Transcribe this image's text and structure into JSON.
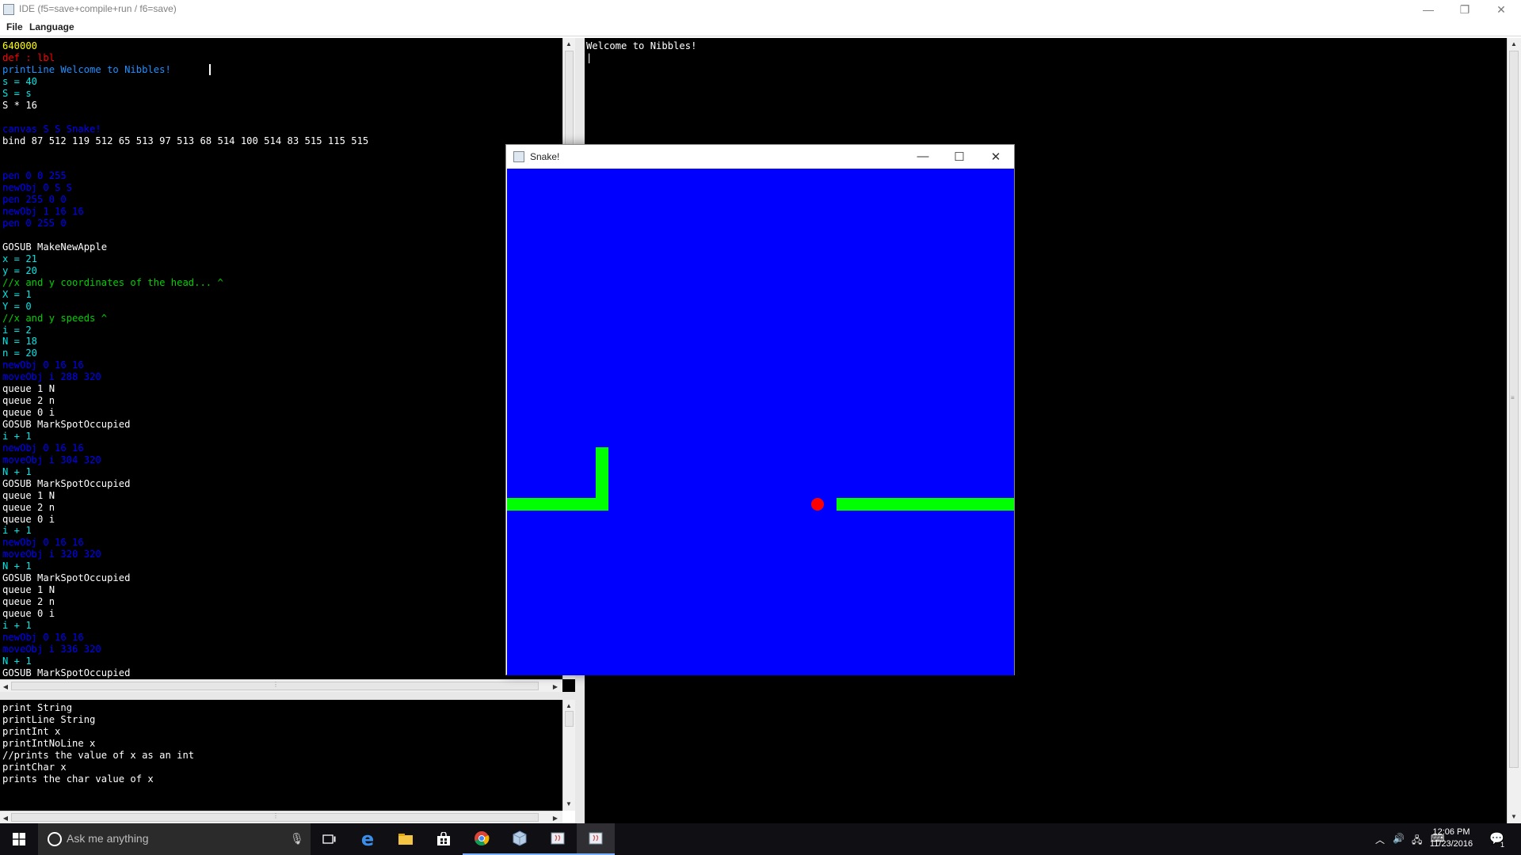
{
  "window": {
    "title": "IDE (f5=save+compile+run / f6=save)",
    "controls": {
      "minimize": "—",
      "restore": "❐",
      "close": "✕"
    }
  },
  "menu": [
    "File",
    "Language"
  ],
  "editor": {
    "lines": [
      {
        "t": "640000",
        "c": "#ffff00"
      },
      {
        "t": "def : lbl",
        "c": "#ff0000"
      },
      {
        "t": "printLine Welcome to Nibbles!",
        "c": "#1e90ff"
      },
      {
        "t": "s = 40",
        "c": "#00e5e5"
      },
      {
        "t": "S = s",
        "c": "#00e5e5"
      },
      {
        "t": "S * 16",
        "c": "#ffffff"
      },
      {
        "t": "",
        "c": "#ffffff"
      },
      {
        "t": "canvas S S Snake!",
        "c": "#0000ff"
      },
      {
        "t": "bind 87 512 119 512 65 513 97 513 68 514 100 514 83 515 115 515",
        "c": "#ffffff"
      },
      {
        "t": "",
        "c": "#ffffff"
      },
      {
        "t": "",
        "c": "#ffffff"
      },
      {
        "t": "pen 0 0 255",
        "c": "#0000ff"
      },
      {
        "t": "newObj 0 S S",
        "c": "#0000ff"
      },
      {
        "t": "pen 255 0 0",
        "c": "#0000ff"
      },
      {
        "t": "newObj 1 16 16",
        "c": "#0000ff"
      },
      {
        "t": "pen 0 255 0",
        "c": "#0000ff"
      },
      {
        "t": "",
        "c": "#ffffff"
      },
      {
        "t": "GOSUB MakeNewApple",
        "c": "#ffffff"
      },
      {
        "t": "x = 21",
        "c": "#00e5e5"
      },
      {
        "t": "y = 20",
        "c": "#00e5e5"
      },
      {
        "t": "//x and y coordinates of the head... ^",
        "c": "#00d000"
      },
      {
        "t": "X = 1",
        "c": "#00e5e5"
      },
      {
        "t": "Y = 0",
        "c": "#00e5e5"
      },
      {
        "t": "//x and y speeds ^",
        "c": "#00d000"
      },
      {
        "t": "i = 2",
        "c": "#00e5e5"
      },
      {
        "t": "N = 18",
        "c": "#00e5e5"
      },
      {
        "t": "n = 20",
        "c": "#00e5e5"
      },
      {
        "t": "newObj 0 16 16",
        "c": "#0000ff"
      },
      {
        "t": "moveObj i 288 320",
        "c": "#0000ff"
      },
      {
        "t": "queue 1 N",
        "c": "#ffffff"
      },
      {
        "t": "queue 2 n",
        "c": "#ffffff"
      },
      {
        "t": "queue 0 i",
        "c": "#ffffff"
      },
      {
        "t": "GOSUB MarkSpotOccupied",
        "c": "#ffffff"
      },
      {
        "t": "i + 1",
        "c": "#00e5e5"
      },
      {
        "t": "newObj 0 16 16",
        "c": "#0000ff"
      },
      {
        "t": "moveObj i 304 320",
        "c": "#0000ff"
      },
      {
        "t": "N + 1",
        "c": "#00e5e5"
      },
      {
        "t": "GOSUB MarkSpotOccupied",
        "c": "#ffffff"
      },
      {
        "t": "queue 1 N",
        "c": "#ffffff"
      },
      {
        "t": "queue 2 n",
        "c": "#ffffff"
      },
      {
        "t": "queue 0 i",
        "c": "#ffffff"
      },
      {
        "t": "i + 1",
        "c": "#00e5e5"
      },
      {
        "t": "newObj 0 16 16",
        "c": "#0000ff"
      },
      {
        "t": "moveObj i 320 320",
        "c": "#0000ff"
      },
      {
        "t": "N + 1",
        "c": "#00e5e5"
      },
      {
        "t": "GOSUB MarkSpotOccupied",
        "c": "#ffffff"
      },
      {
        "t": "queue 1 N",
        "c": "#ffffff"
      },
      {
        "t": "queue 2 n",
        "c": "#ffffff"
      },
      {
        "t": "queue 0 i",
        "c": "#ffffff"
      },
      {
        "t": "i + 1",
        "c": "#00e5e5"
      },
      {
        "t": "newObj 0 16 16",
        "c": "#0000ff"
      },
      {
        "t": "moveObj i 336 320",
        "c": "#0000ff"
      },
      {
        "t": "N + 1",
        "c": "#00e5e5"
      },
      {
        "t": "GOSUB MarkSpotOccupied",
        "c": "#ffffff"
      }
    ]
  },
  "help": {
    "lines": [
      "print String",
      "printLine String",
      "printInt x",
      "printIntNoLine x",
      "//prints the value of x as an int",
      "printChar x",
      "prints the char value of x"
    ]
  },
  "console": {
    "lines": [
      "Welcome to Nibbles!",
      "|"
    ]
  },
  "snake_window": {
    "title": "Snake!",
    "controls": {
      "minimize": "—",
      "maximize": "☐",
      "close": "✕"
    }
  },
  "game": {
    "grid_cells": 40,
    "colors": {
      "background": "#0000ff",
      "snake": "#00ff00",
      "apple": "#ff0000"
    },
    "snake_segments": [
      {
        "col": 0,
        "row": 26
      },
      {
        "col": 1,
        "row": 26
      },
      {
        "col": 2,
        "row": 26
      },
      {
        "col": 3,
        "row": 26
      },
      {
        "col": 4,
        "row": 26
      },
      {
        "col": 5,
        "row": 26
      },
      {
        "col": 6,
        "row": 26
      },
      {
        "col": 7,
        "row": 26
      },
      {
        "col": 7,
        "row": 25
      },
      {
        "col": 7,
        "row": 24
      },
      {
        "col": 7,
        "row": 23
      },
      {
        "col": 7,
        "row": 22
      },
      {
        "col": 26,
        "row": 26
      },
      {
        "col": 27,
        "row": 26
      },
      {
        "col": 28,
        "row": 26
      },
      {
        "col": 29,
        "row": 26
      },
      {
        "col": 30,
        "row": 26
      },
      {
        "col": 31,
        "row": 26
      },
      {
        "col": 32,
        "row": 26
      },
      {
        "col": 33,
        "row": 26
      },
      {
        "col": 34,
        "row": 26
      },
      {
        "col": 35,
        "row": 26
      },
      {
        "col": 36,
        "row": 26
      },
      {
        "col": 37,
        "row": 26
      },
      {
        "col": 38,
        "row": 26
      },
      {
        "col": 39,
        "row": 26
      }
    ],
    "apple": {
      "col": 24,
      "row": 26
    }
  },
  "taskbar": {
    "search_placeholder": "Ask me anything",
    "apps": [
      "task-view",
      "edge",
      "file-explorer",
      "store",
      "chrome",
      "virtualbox",
      "java-app",
      "java-app-active"
    ],
    "time": "12:06 PM",
    "date": "11/23/2016",
    "notification_count": "1"
  }
}
